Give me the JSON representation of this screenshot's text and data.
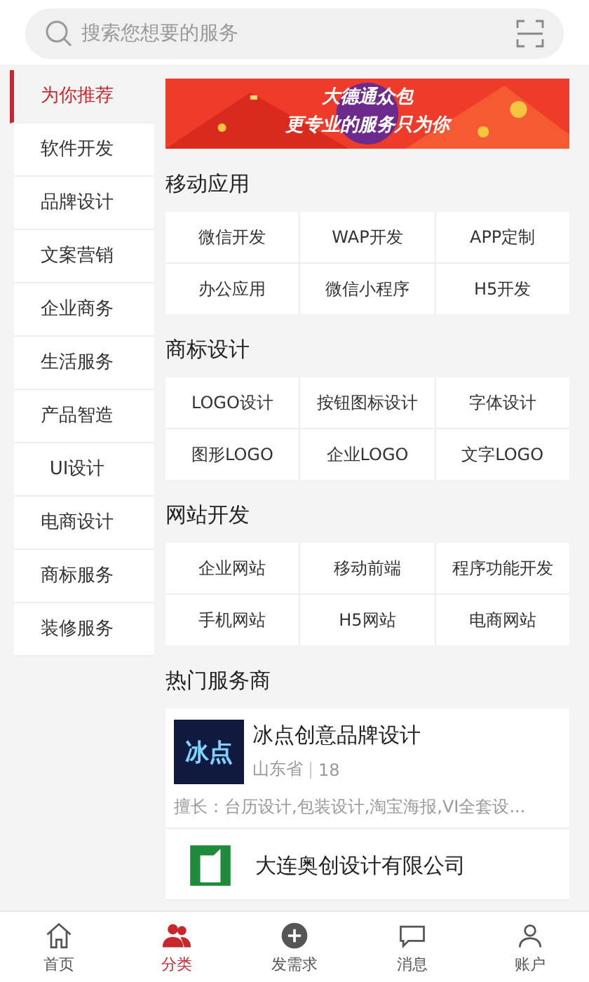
{
  "search": {
    "placeholder": "搜索您想要的服务"
  },
  "sidebar": {
    "items": [
      {
        "label": "为你推荐",
        "selected": true
      },
      {
        "label": "软件开发",
        "selected": false
      },
      {
        "label": "品牌设计",
        "selected": false
      },
      {
        "label": "文案营销",
        "selected": false
      },
      {
        "label": "企业商务",
        "selected": false
      },
      {
        "label": "生活服务",
        "selected": false
      },
      {
        "label": "产品智造",
        "selected": false
      },
      {
        "label": "UI设计",
        "selected": false
      },
      {
        "label": "电商设计",
        "selected": false
      },
      {
        "label": "商标服务",
        "selected": false
      },
      {
        "label": "装修服务",
        "selected": false
      }
    ]
  },
  "banner": {
    "lines": [
      "大德通众包",
      "更专业的服务只为你"
    ]
  },
  "sections": [
    {
      "title": "移动应用",
      "items": [
        "微信开发",
        "WAP开发",
        "APP定制",
        "办公应用",
        "微信小程序",
        "H5开发"
      ]
    },
    {
      "title": "商标设计",
      "items": [
        "LOGO设计",
        "按钮图标设计",
        "字体设计",
        "图形LOGO",
        "企业LOGO",
        "文字LOGO"
      ]
    },
    {
      "title": "网站开发",
      "items": [
        "企业网站",
        "移动前端",
        "程序功能开发",
        "手机网站",
        "H5网站",
        "电商网站"
      ]
    }
  ],
  "providers": {
    "title": "热门服务商",
    "items": [
      {
        "logo": {
          "kind": "text",
          "text": "冰点"
        },
        "name": "冰点创意品牌设计",
        "location": "山东省",
        "count": "18",
        "specialty": "擅长：台历设计,包装设计,淘宝海报,VI全套设..."
      },
      {
        "logo": {
          "kind": "mark"
        },
        "name": "大连奥创设计有限公司"
      }
    ]
  },
  "tabbar": [
    {
      "label": "首页",
      "kind": "home",
      "selected": false
    },
    {
      "label": "分类",
      "kind": "people",
      "selected": true
    },
    {
      "label": "发需求",
      "kind": "post",
      "selected": false
    },
    {
      "label": "消息",
      "kind": "chat",
      "selected": false
    },
    {
      "label": "账户",
      "kind": "user",
      "selected": false
    }
  ]
}
